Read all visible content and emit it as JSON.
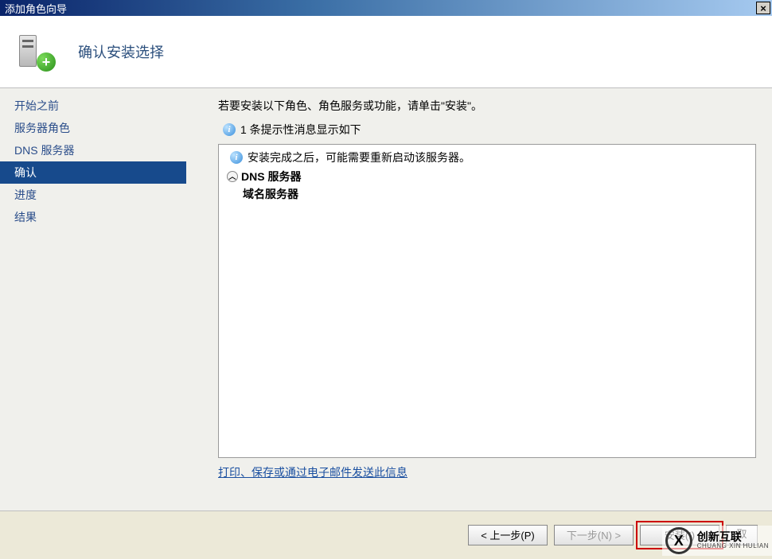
{
  "titlebar": {
    "title": "添加角色向导",
    "close_label": "×"
  },
  "header": {
    "title": "确认安装选择"
  },
  "sidebar": {
    "steps": [
      "开始之前",
      "服务器角色",
      "DNS 服务器",
      "确认",
      "进度",
      "结果"
    ],
    "selected_index": 3
  },
  "main": {
    "intro": "若要安装以下角色、角色服务或功能，请单击\"安装\"。",
    "info_text": "1 条提示性消息显示如下",
    "warning_text": "安装完成之后，可能需要重新启动该服务器。",
    "role_name": "DNS 服务器",
    "role_description": "域名服务器",
    "link_text": "打印、保存或通过电子邮件发送此信息"
  },
  "footer": {
    "prev": "< 上一步(P)",
    "next": "下一步(N) >",
    "install": "安装(I)",
    "cancel": "取消"
  },
  "watermark": {
    "cn": "创新互联",
    "en": "CHUANG XIN HULIAN",
    "icon_letter": "X"
  }
}
